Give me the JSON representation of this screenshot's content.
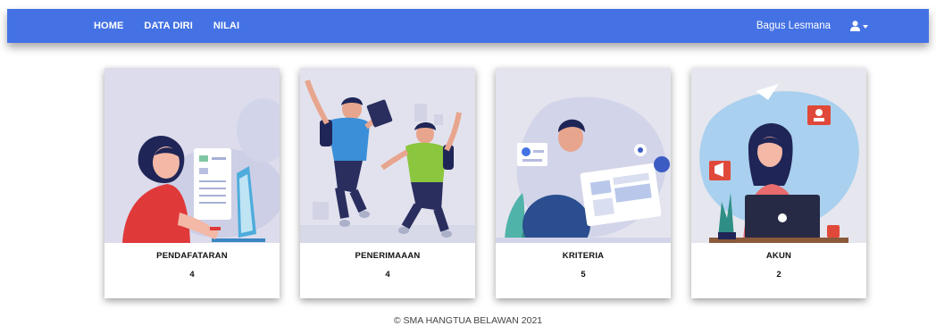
{
  "navbar": {
    "links": [
      "HOME",
      "DATA DIRI",
      "NILAI"
    ],
    "user_name": "Bagus Lesmana",
    "user_icon": "user-icon",
    "accent_color": "#4472e4"
  },
  "cards": [
    {
      "title": "PENDAFATARAN",
      "count": "4",
      "illustration": "woman-computer-checklist"
    },
    {
      "title": "PENERIMAAAN",
      "count": "4",
      "illustration": "students-jumping"
    },
    {
      "title": "KRITERIA",
      "count": "5",
      "illustration": "man-browser-window"
    },
    {
      "title": "AKUN",
      "count": "2",
      "illustration": "woman-laptop-social"
    }
  ],
  "footer": {
    "text": "© SMA HANGTUA BELAWAN 2021"
  }
}
